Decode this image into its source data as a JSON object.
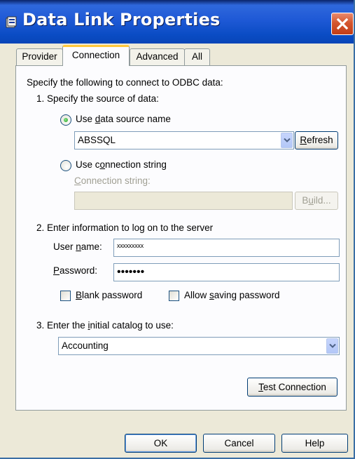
{
  "window": {
    "title": "Data Link Properties"
  },
  "tabs": [
    {
      "label": "Provider"
    },
    {
      "label": "Connection"
    },
    {
      "label": "Advanced"
    },
    {
      "label": "All"
    }
  ],
  "connection": {
    "intro": "Specify the following to connect to ODBC data:",
    "step1": "1. Specify the source of data:",
    "use_dsn": {
      "pre": "Use ",
      "key": "d",
      "post": "ata source name",
      "selected": true
    },
    "dsn_value": "ABSSQL",
    "refresh": {
      "key": "R",
      "post": "efresh"
    },
    "use_connstr": {
      "pre": "Use c",
      "key": "o",
      "post": "nnection string",
      "selected": false
    },
    "connstr_label": {
      "key": "C",
      "post": "onnection string:"
    },
    "connstr_value": "",
    "build": {
      "pre": "B",
      "key": "u",
      "post": "ild..."
    },
    "step2": "2. Enter information to log on to the server",
    "username_label": {
      "pre": "User ",
      "key": "n",
      "post": "ame:"
    },
    "username_value": "xxxxxxxxx",
    "password_label": {
      "key": "P",
      "post": "assword:"
    },
    "password_value": "•••••••",
    "blank_password": {
      "key": "B",
      "post": "lank password",
      "checked": false
    },
    "allow_saving": {
      "pre": "Allow ",
      "key": "s",
      "post": "aving password",
      "checked": false
    },
    "step3": {
      "pre": "3. Enter the ",
      "key": "i",
      "post": "nitial catalog to use:"
    },
    "catalog_value": "Accounting",
    "test_connection": {
      "key": "T",
      "post": "est Connection"
    }
  },
  "footer": {
    "ok": "OK",
    "cancel": "Cancel",
    "help": "Help"
  },
  "colors": {
    "titlebar": "#0a4cc4",
    "close": "#c23d17",
    "tab_highlight": "#ffc83c",
    "dialog_bg": "#ece9d8"
  }
}
